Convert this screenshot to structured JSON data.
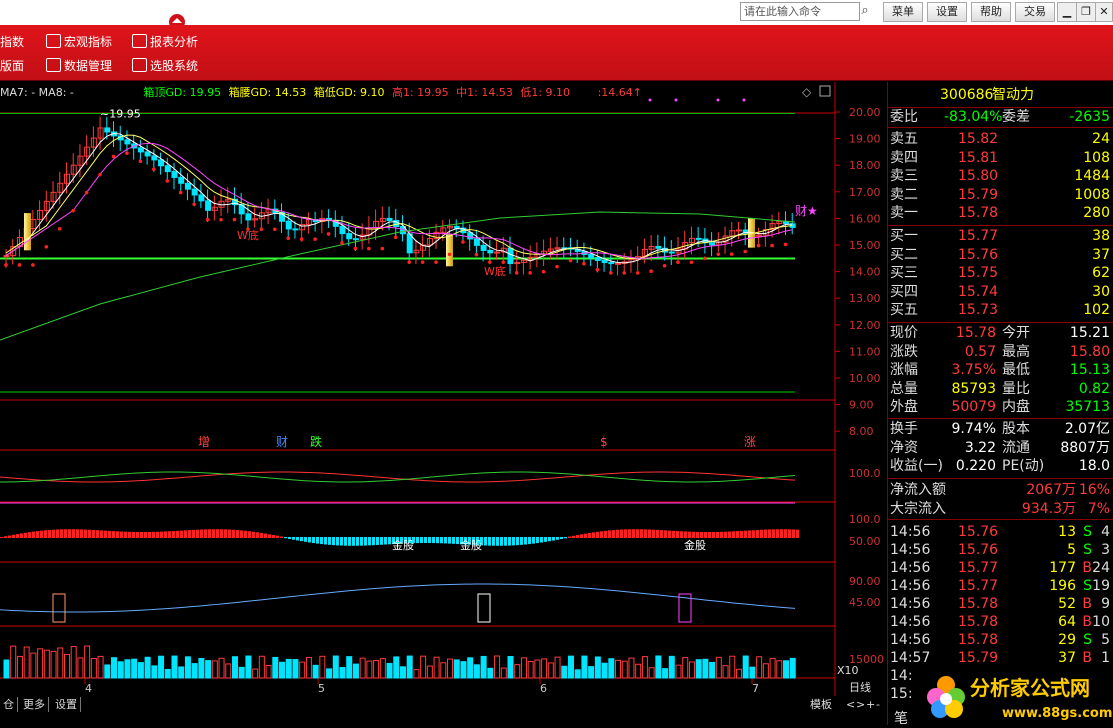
{
  "window": {
    "command_placeholder": "请在此输入命令",
    "buttons": [
      "菜单",
      "设置",
      "帮助",
      "交易"
    ]
  },
  "toolbar": {
    "items": [
      {
        "label": "指数",
        "icon": "chart-icon"
      },
      {
        "label": "宏观指标",
        "icon": "chart-icon"
      },
      {
        "label": "报表分析",
        "icon": "grid-icon"
      },
      {
        "label": "版面",
        "icon": "layout-icon"
      },
      {
        "label": "数据管理",
        "icon": "database-icon"
      },
      {
        "label": "选股系统",
        "icon": "filter-icon"
      }
    ]
  },
  "legend": {
    "ma": "MA7: -  MA8: -",
    "box_top": "箱顶GD: 19.95",
    "box_mid": "箱腰GD: 14.53",
    "box_low": "箱低GD: 9.10",
    "high": "高1: 19.95",
    "mid": "中1: 14.53",
    "low": "低1: 9.10",
    "current": ":14.64↑"
  },
  "chart_annotations": {
    "peak_label": "19.95",
    "w_bottom_1": "W底",
    "w_bottom_2": "W底",
    "cai_star": "财★",
    "markers": [
      "增",
      "财",
      "跌",
      "$",
      "涨"
    ],
    "gold_labels": [
      "金股",
      "金股",
      "金股"
    ],
    "x10": "X10",
    "daily": "日线"
  },
  "axis": {
    "price_ticks": [
      "20.00",
      "19.00",
      "18.00",
      "17.00",
      "16.00",
      "15.00",
      "14.00",
      "13.00",
      "12.00",
      "11.00",
      "10.00",
      "9.00",
      "8.00"
    ],
    "ind1_ticks": [
      "100.0"
    ],
    "ind2_ticks": [
      "100.0",
      "50.00"
    ],
    "ind3_ticks": [
      "90.00",
      "45.00"
    ],
    "vol_ticks": [
      "15000"
    ],
    "x_ticks": [
      "4",
      "5",
      "6",
      "7"
    ]
  },
  "colors": {
    "up": "#ff3b3b",
    "down": "#00e5ff",
    "box_line": "#00ff00",
    "gold_candle": "#ffd700",
    "ma_white": "#ffffff",
    "ma_yellow": "#ffff66",
    "ma_magenta": "#ff44ff",
    "ma_green": "#33cc33"
  },
  "quote": {
    "code": "300686",
    "name": "智动力",
    "weibi_label": "委比",
    "weibi": "-83.04%",
    "weicha_label": "委差",
    "weicha": "-2635",
    "asks": [
      {
        "label": "卖五",
        "price": "15.82",
        "vol": "24"
      },
      {
        "label": "卖四",
        "price": "15.81",
        "vol": "108"
      },
      {
        "label": "卖三",
        "price": "15.80",
        "vol": "1484"
      },
      {
        "label": "卖二",
        "price": "15.79",
        "vol": "1008"
      },
      {
        "label": "卖一",
        "price": "15.78",
        "vol": "280"
      }
    ],
    "bids": [
      {
        "label": "买一",
        "price": "15.77",
        "vol": "38"
      },
      {
        "label": "买二",
        "price": "15.76",
        "vol": "37"
      },
      {
        "label": "买三",
        "price": "15.75",
        "vol": "62"
      },
      {
        "label": "买四",
        "price": "15.74",
        "vol": "30"
      },
      {
        "label": "买五",
        "price": "15.73",
        "vol": "102"
      }
    ],
    "stats": [
      {
        "l1": "现价",
        "v1": "15.78",
        "c1": "#ff3b3b",
        "l2": "今开",
        "v2": "15.21",
        "c2": "#ffffff"
      },
      {
        "l1": "涨跌",
        "v1": "0.57",
        "c1": "#ff3b3b",
        "l2": "最高",
        "v2": "15.80",
        "c2": "#ff3b3b"
      },
      {
        "l1": "涨幅",
        "v1": "3.75%",
        "c1": "#ff3b3b",
        "l2": "最低",
        "v2": "15.13",
        "c2": "#00ff00"
      },
      {
        "l1": "总量",
        "v1": "85793",
        "c1": "#ffff00",
        "l2": "量比",
        "v2": "0.82",
        "c2": "#00ff00"
      },
      {
        "l1": "外盘",
        "v1": "50079",
        "c1": "#ff3b3b",
        "l2": "内盘",
        "v2": "35713",
        "c2": "#00ff00"
      }
    ],
    "stats2": [
      {
        "l1": "换手",
        "v1": "9.74%",
        "l2": "股本",
        "v2": "2.07亿"
      },
      {
        "l1": "净资",
        "v1": "3.22",
        "l2": "流通",
        "v2": "8807万"
      },
      {
        "l1": "收益(一)",
        "v1": "0.220",
        "l2": "PE(动)",
        "v2": "18.0"
      }
    ],
    "flow": [
      {
        "label": "净流入额",
        "value": "2067万",
        "pct": "16%"
      },
      {
        "label": "大宗流入",
        "value": "934.3万",
        "pct": "7%"
      }
    ],
    "ticks": [
      {
        "time": "14:56",
        "price": "15.76",
        "vol": "13",
        "bs": "S",
        "n": "4"
      },
      {
        "time": "14:56",
        "price": "15.76",
        "vol": "5",
        "bs": "S",
        "n": "3"
      },
      {
        "time": "14:56",
        "price": "15.77",
        "vol": "177",
        "bs": "B",
        "n": "24"
      },
      {
        "time": "14:56",
        "price": "15.77",
        "vol": "196",
        "bs": "S",
        "n": "19"
      },
      {
        "time": "14:56",
        "price": "15.78",
        "vol": "52",
        "bs": "B",
        "n": "9"
      },
      {
        "time": "14:56",
        "price": "15.78",
        "vol": "64",
        "bs": "B",
        "n": "10"
      },
      {
        "time": "14:56",
        "price": "15.78",
        "vol": "29",
        "bs": "S",
        "n": "5"
      },
      {
        "time": "14:57",
        "price": "15.79",
        "vol": "37",
        "bs": "B",
        "n": "1"
      },
      {
        "time": "14:",
        "price": "",
        "vol": "",
        "bs": "",
        "n": ""
      },
      {
        "time": "15:",
        "price": "",
        "vol": "",
        "bs": "",
        "n": ""
      }
    ]
  },
  "bottom": {
    "buttons": [
      "仓",
      "更多",
      "设置"
    ],
    "right_label": "模板",
    "right_nav": [
      "<",
      ">",
      "+",
      "-"
    ],
    "panel_tab": "笔"
  },
  "watermark": {
    "text": "分析家公式网",
    "url": "www.88gs.com"
  }
}
